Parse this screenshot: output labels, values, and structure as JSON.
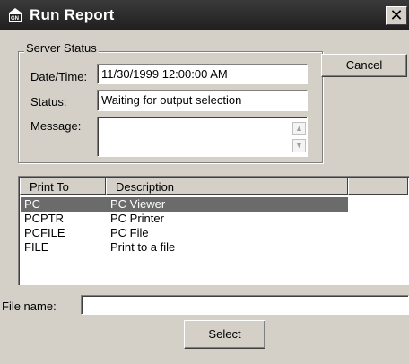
{
  "window": {
    "title": "Run Report",
    "close_glyph": "✕"
  },
  "icon": {
    "app": "gn-app-icon"
  },
  "server_status": {
    "label": "Server Status",
    "date_label": "Date/Time:",
    "date_value": "11/30/1999 12:00:00 AM",
    "status_label": "Status:",
    "status_value": "Waiting for output selection",
    "message_label": "Message:",
    "message_value": ""
  },
  "buttons": {
    "cancel": "Cancel",
    "select": "Select"
  },
  "list": {
    "columns": [
      "Print To",
      "Description"
    ],
    "rows": [
      {
        "print_to": "PC",
        "description": "PC Viewer",
        "selected": true
      },
      {
        "print_to": "PCPTR",
        "description": "PC Printer",
        "selected": false
      },
      {
        "print_to": "PCFILE",
        "description": "PC File",
        "selected": false
      },
      {
        "print_to": "FILE",
        "description": "Print to a file",
        "selected": false
      }
    ]
  },
  "file": {
    "label": "File name:",
    "value": ""
  },
  "colors": {
    "title_bar": "#2a2a2a",
    "selection": "#6b6b6b",
    "face": "#d4d0c8"
  }
}
